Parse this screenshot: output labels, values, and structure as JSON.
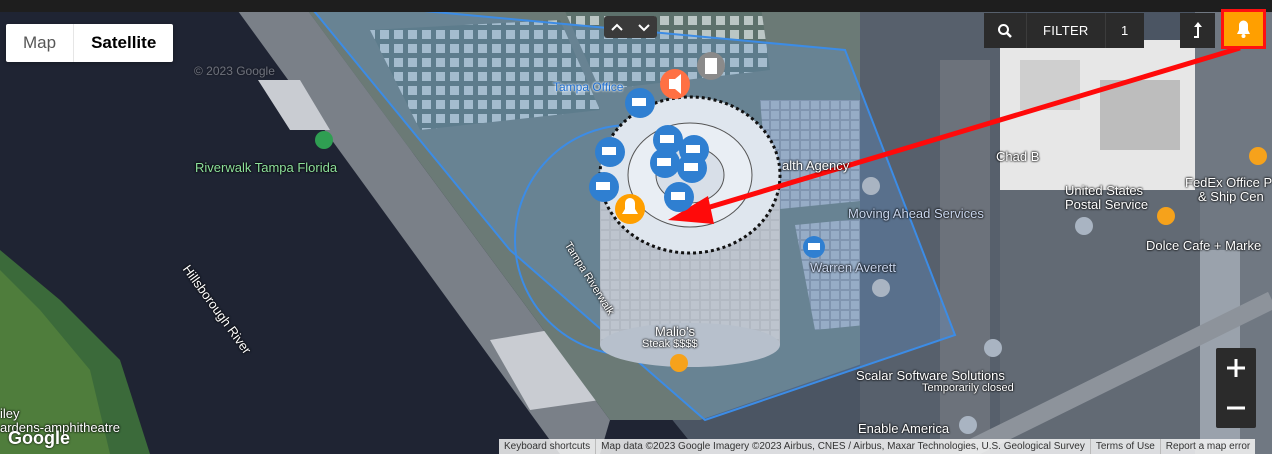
{
  "map_type": {
    "map_label": "Map",
    "satellite_label": "Satellite",
    "active": "Satellite"
  },
  "toolbar": {
    "filter_label": "FILTER",
    "filter_count": "1"
  },
  "zoom": {
    "in_label": "+",
    "out_label": "−"
  },
  "google_logo": "Google",
  "attribution": {
    "shortcuts": "Keyboard shortcuts",
    "map_data": "Map data ©2023 Google Imagery ©2023 Airbus, CNES / Airbus, Maxar Technologies, U.S. Geological Survey",
    "terms": "Terms of Use",
    "report": "Report a map error"
  },
  "labels": {
    "riverwalk": "Riverwalk Tampa Florida",
    "river": "Hillsborough River",
    "tampa_office": "Tampa Office",
    "health_agency": "alth Agency",
    "moving_ahead": "Moving Ahead Services",
    "warren": "Warren Averett",
    "chad": "Chad B",
    "usps_1": "United States",
    "usps_2": "Postal Service",
    "fedex_1": "FedEx Office P",
    "fedex_2": "& Ship Cen",
    "dolce": "Dolce Cafe + Marke",
    "scalar": "Scalar Software Solutions",
    "scalar_status": "Temporarily closed",
    "enable": "Enable America",
    "malios_1": "Malio's",
    "malios_2": "Steak $$$$",
    "riverwalk_path": "Tampa Riverwalk",
    "amphi_1": "iley",
    "amphi_2": "ardens-amphitheatre",
    "watermark": "© 2023 Google"
  },
  "colors": {
    "alert": "#ff9f00",
    "alert_border": "#ff1010",
    "camera": "#2f7fd1",
    "geofence": "#3c8ce6",
    "arrow": "#ff0a0a",
    "speaker": "#ff7043"
  }
}
